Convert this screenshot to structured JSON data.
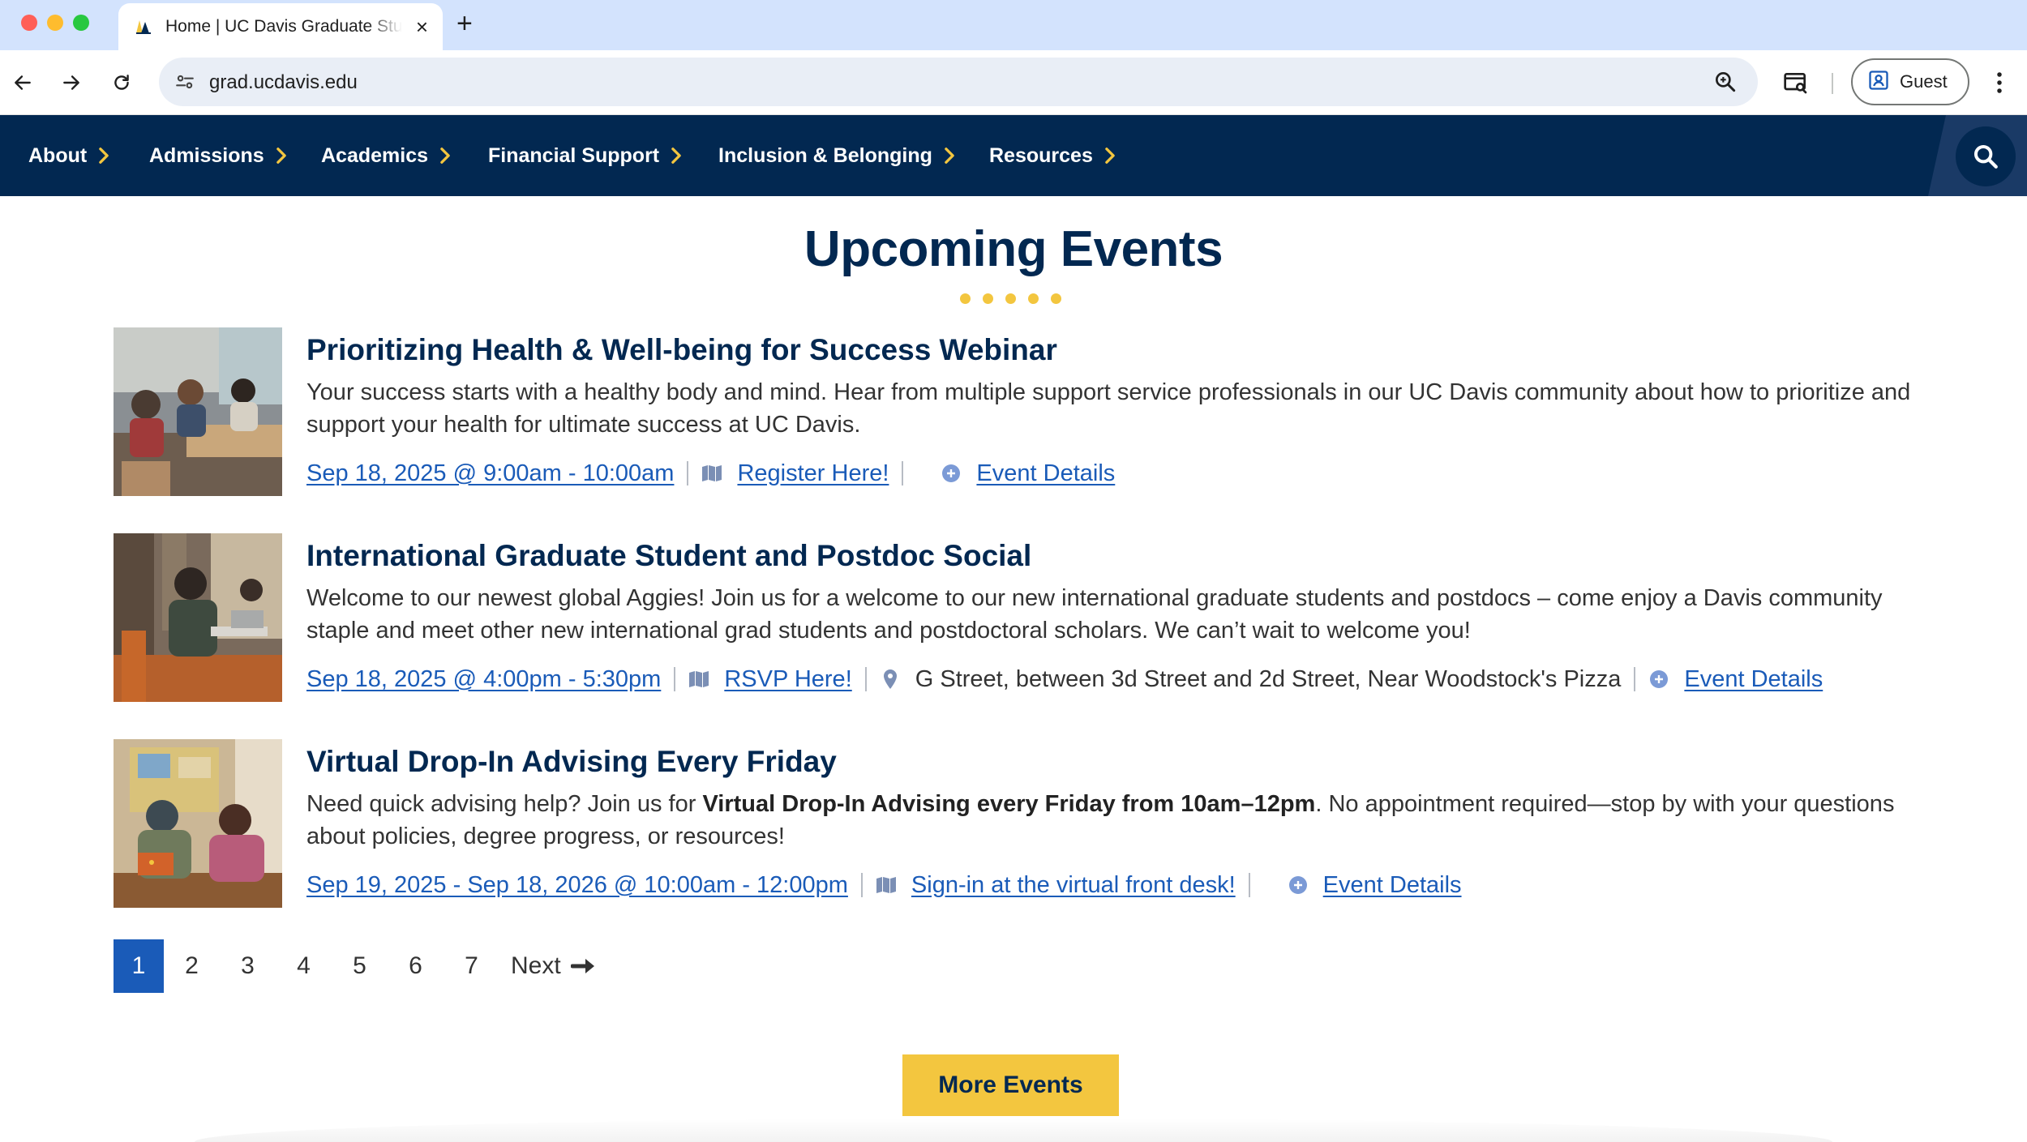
{
  "browser": {
    "tab_title": "Home | UC Davis Graduate Studies",
    "url": "grad.ucdavis.edu",
    "profile_label": "Guest",
    "icons": [
      "back-icon",
      "forward-icon",
      "reload-icon",
      "site-settings-icon",
      "zoom-icon",
      "tab-search-icon",
      "profile-icon",
      "kebab-menu-icon"
    ]
  },
  "nav": {
    "items": [
      {
        "label": "About"
      },
      {
        "label": "Admissions"
      },
      {
        "label": "Academics"
      },
      {
        "label": "Financial Support"
      },
      {
        "label": "Inclusion & Belonging"
      },
      {
        "label": "Resources"
      }
    ]
  },
  "events_section": {
    "title": "Upcoming Events",
    "events": [
      {
        "title": "Prioritizing Health & Well-being for Success Webinar",
        "description": "Your success starts with a healthy body and mind. Hear from multiple support service professionals in our UC Davis community about how to prioritize and support your health for ultimate success at UC Davis.",
        "date": "Sep 18, 2025 @ 9:00am - 10:00am",
        "location_link": "Register Here!",
        "details_link": "Event Details"
      },
      {
        "title": "International Graduate Student and Postdoc Social",
        "description": "Welcome to our newest global Aggies! Join us for a welcome to our new international graduate students and postdocs – come enjoy a Davis community staple and meet other new international grad students and postdoctoral scholars. We can’t wait to welcome you!",
        "date": "Sep 18, 2025 @ 4:00pm - 5:30pm",
        "location_link": "RSVP Here!",
        "address": "G Street, between 3d Street and 2d Street, Near Woodstock's Pizza",
        "details_link": "Event Details"
      },
      {
        "title": "Virtual Drop-In Advising Every Friday",
        "description_before": "Need quick advising help? Join us for ",
        "description_bold": "Virtual Drop-In Advising every Friday from 10am–12pm",
        "description_after": ". No appointment required—stop by with your questions about policies, degree progress, or resources!",
        "date": "Sep 19, 2025 - Sep 18, 2026 @ 10:00am - 12:00pm",
        "location_link": "Sign-in at the virtual front desk!",
        "details_link": "Event Details"
      }
    ]
  },
  "pager": {
    "current": "1",
    "pages": [
      "2",
      "3",
      "4",
      "5",
      "6",
      "7"
    ],
    "next_label": "Next"
  },
  "more_button": "More Events",
  "colors": {
    "navy": "#022851",
    "gold": "#f3c63f",
    "link": "#1a5bb8",
    "tab_strip": "#d3e3fd"
  }
}
